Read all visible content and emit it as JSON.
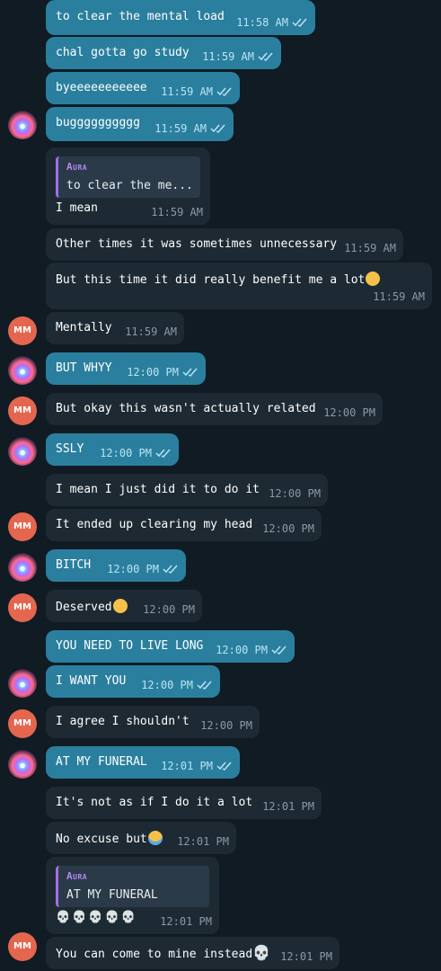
{
  "colors": {
    "outgoing": "#2b7f9e",
    "incoming": "#1d2a33",
    "background": "#101b23",
    "avatar_mm": "#e4664f",
    "reply_accent": "#a46ee8"
  },
  "messages": [
    {
      "dir": "out",
      "text": "to clear the mental load",
      "time": "11:58 AM",
      "ticks": true
    },
    {
      "dir": "out",
      "text": "chal gotta go study",
      "time": "11:59 AM",
      "ticks": true
    },
    {
      "dir": "out",
      "text": "byeeeeeeeeeee",
      "time": "11:59 AM",
      "ticks": true
    },
    {
      "dir": "out",
      "text": "bugggggggggg",
      "time": "11:59 AM",
      "ticks": true,
      "avatar": "aura"
    },
    {
      "dir": "in",
      "text": "I mean",
      "time": "11:59 AM",
      "reply": {
        "name": "Aura",
        "text": "to clear the me..."
      }
    },
    {
      "dir": "in",
      "text": "Other times it was sometimes unnecessary",
      "time": "11:59 AM"
    },
    {
      "dir": "in",
      "text": "But this time it did really benefit me a lot",
      "time": "11:59 AM",
      "emoji": "pleading-face-icon"
    },
    {
      "dir": "in",
      "text": "Mentally",
      "time": "11:59 AM",
      "avatar": "mm",
      "avatar_text": "MM"
    },
    {
      "dir": "out",
      "text": "BUT WHYY",
      "time": "12:00 PM",
      "ticks": true,
      "avatar": "aura"
    },
    {
      "dir": "in",
      "text": "But okay this wasn't actually related",
      "time": "12:00 PM",
      "avatar": "mm",
      "avatar_text": "MM"
    },
    {
      "dir": "out",
      "text": "SSLY",
      "time": "12:00 PM",
      "ticks": true,
      "avatar": "aura"
    },
    {
      "dir": "in",
      "text": "I mean I just did it to do it",
      "time": "12:00 PM"
    },
    {
      "dir": "in",
      "text": "It ended up clearing my head",
      "time": "12:00 PM",
      "avatar": "mm",
      "avatar_text": "MM"
    },
    {
      "dir": "out",
      "text": "BITCH",
      "time": "12:00 PM",
      "ticks": true,
      "avatar": "aura"
    },
    {
      "dir": "in",
      "text": "Deserved",
      "time": "12:00 PM",
      "emoji": "pleading-face-icon",
      "avatar": "mm",
      "avatar_text": "MM"
    },
    {
      "dir": "out",
      "text": "YOU NEED TO LIVE LONG",
      "time": "12:00 PM",
      "ticks": true
    },
    {
      "dir": "out",
      "text": "I WANT YOU",
      "time": "12:00 PM",
      "ticks": true,
      "avatar": "aura"
    },
    {
      "dir": "in",
      "text": "I agree I shouldn't",
      "time": "12:00 PM",
      "avatar": "mm",
      "avatar_text": "MM"
    },
    {
      "dir": "out",
      "text": "AT MY FUNERAL",
      "time": "12:01 PM",
      "ticks": true,
      "avatar": "aura"
    },
    {
      "dir": "in",
      "text": "It's not as if I do it a lot",
      "time": "12:01 PM"
    },
    {
      "dir": "in",
      "text": "No excuse but",
      "time": "12:01 PM",
      "emoji": "crying-face-icon"
    },
    {
      "dir": "in",
      "text": "💀💀💀💀💀",
      "time": "12:01 PM",
      "reply": {
        "name": "Aura",
        "text": "AT MY FUNERAL"
      }
    },
    {
      "dir": "in",
      "text": "You can come to mine instead",
      "time": "12:01 PM",
      "emoji": "skull-icon",
      "avatar": "mm",
      "avatar_text": "MM"
    }
  ]
}
